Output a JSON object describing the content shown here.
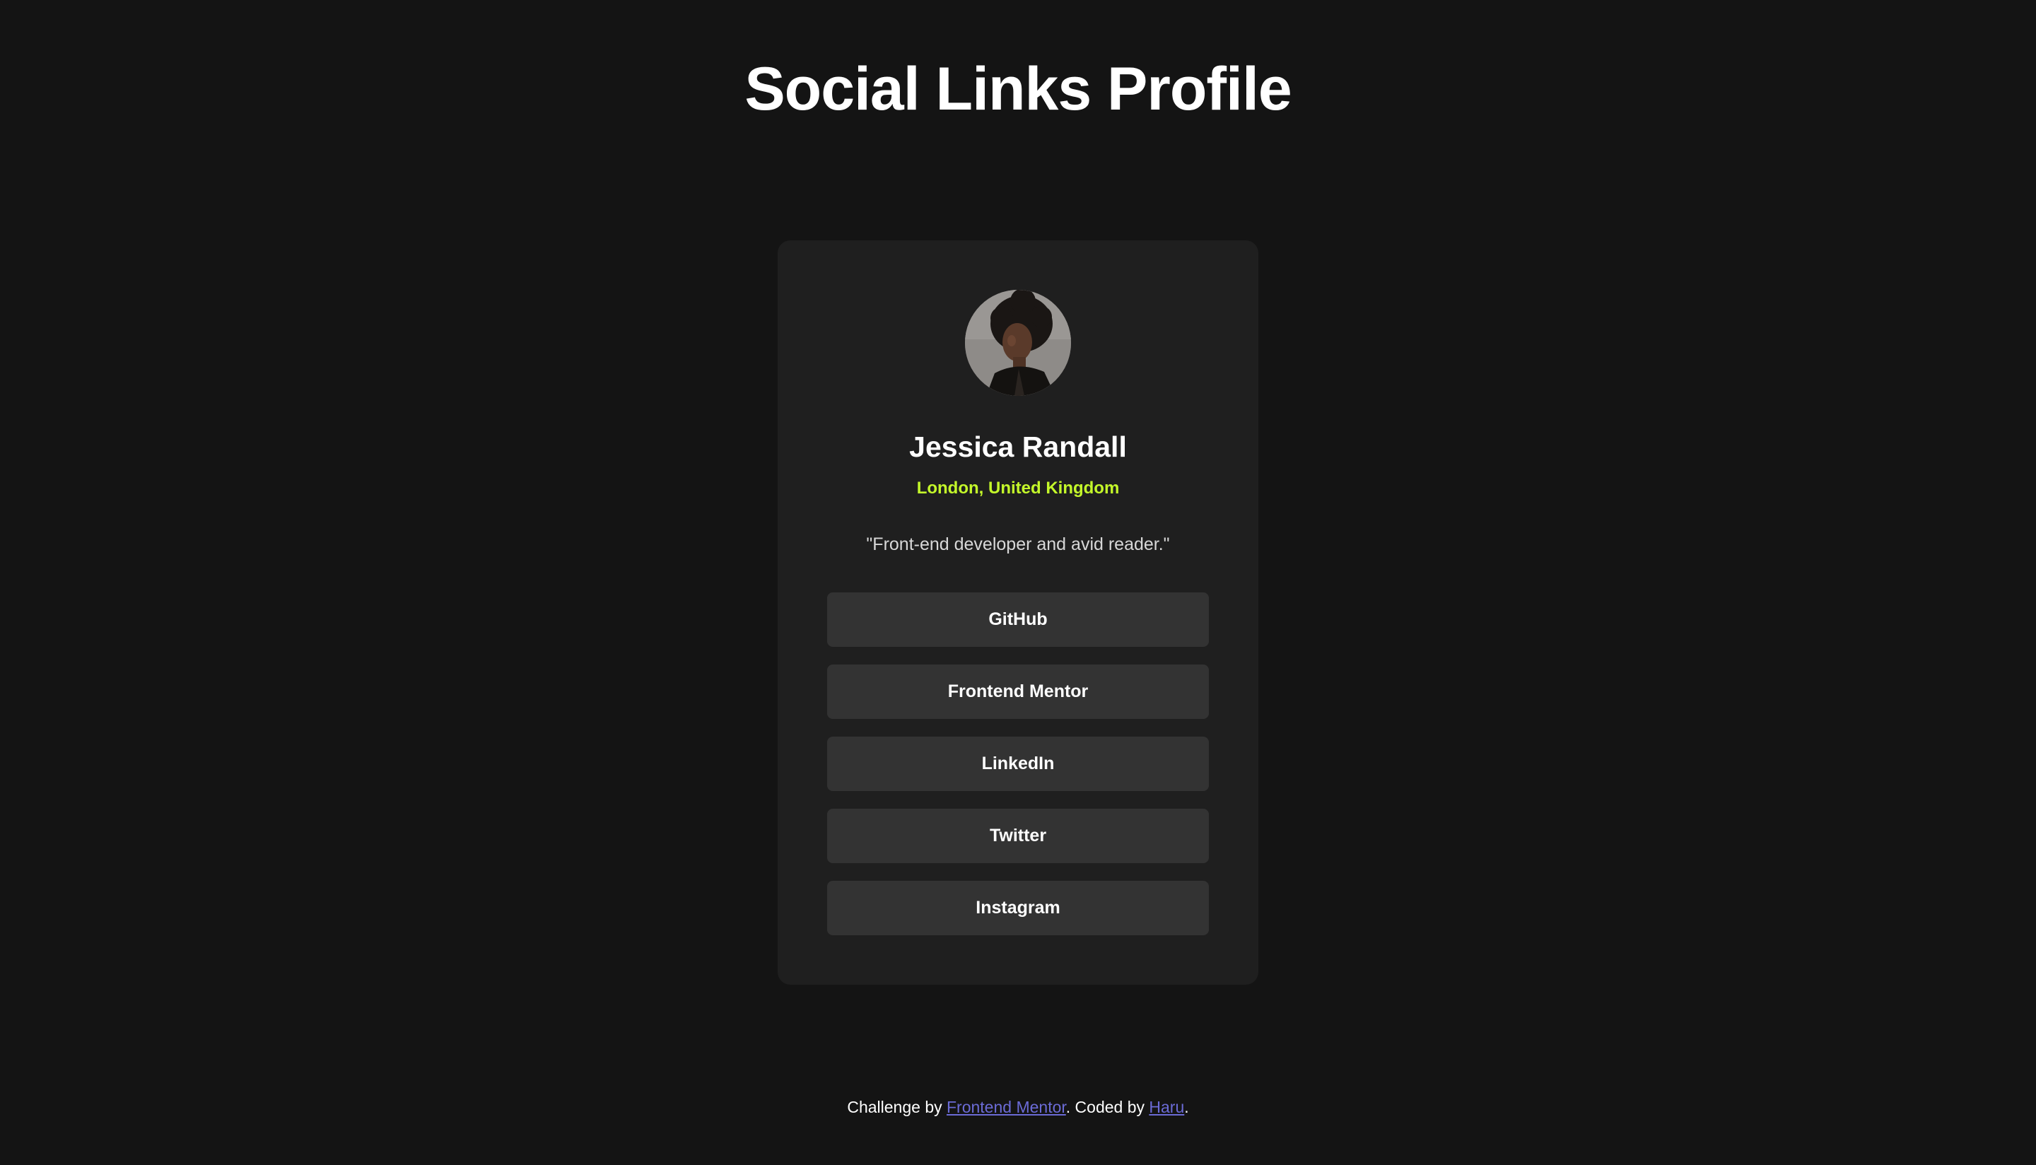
{
  "page": {
    "title": "Social Links Profile"
  },
  "profile": {
    "name": "Jessica Randall",
    "location": "London, United Kingdom",
    "bio": "\"Front-end developer and avid reader.\""
  },
  "links": [
    {
      "label": "GitHub"
    },
    {
      "label": "Frontend Mentor"
    },
    {
      "label": "LinkedIn"
    },
    {
      "label": "Twitter"
    },
    {
      "label": "Instagram"
    }
  ],
  "footer": {
    "prefix": "Challenge by ",
    "challenge_link": "Frontend Mentor",
    "middle": ". Coded by ",
    "author_link": "Haru",
    "suffix": "."
  },
  "colors": {
    "background": "#141414",
    "card": "#1f1f1f",
    "button": "#333333",
    "accent": "#c4f82a",
    "link": "#6b6bd6"
  },
  "icons": {
    "avatar": "profile-photo"
  }
}
